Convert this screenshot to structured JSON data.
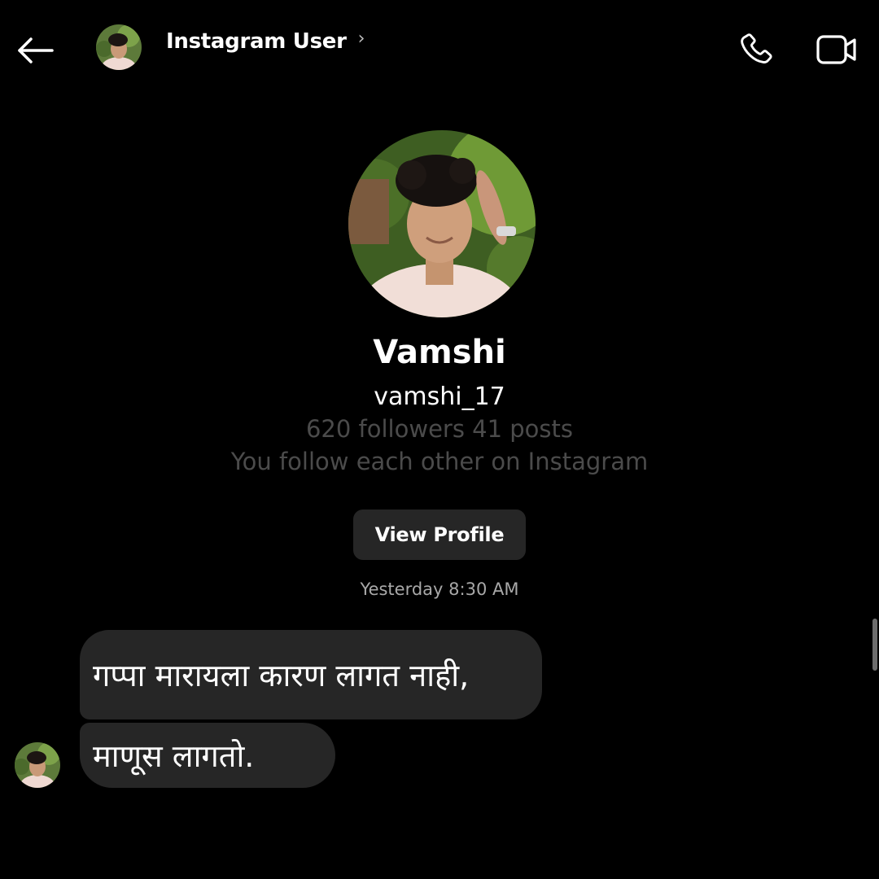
{
  "header": {
    "title": "Instagram User",
    "chevron": "›",
    "icons": {
      "back": "back-arrow-icon",
      "call": "phone-icon",
      "video": "video-camera-icon"
    }
  },
  "profile": {
    "name": "Vamshi",
    "handle": "vamshi_17",
    "stats": "620 followers 41 posts",
    "mutual": "You follow each other on Instagram",
    "button_label": "View Profile"
  },
  "thread": {
    "timestamp": "Yesterday 8:30 AM",
    "messages": [
      {
        "text": "गप्पा मारायला कारण लागत नाही,"
      },
      {
        "text": "माणूस लागतो."
      }
    ]
  },
  "colors": {
    "background": "#000000",
    "bubble": "#262626",
    "muted_text": "#4b4b4b",
    "timestamp_text": "#a8a8a8",
    "primary_text": "#ffffff"
  }
}
